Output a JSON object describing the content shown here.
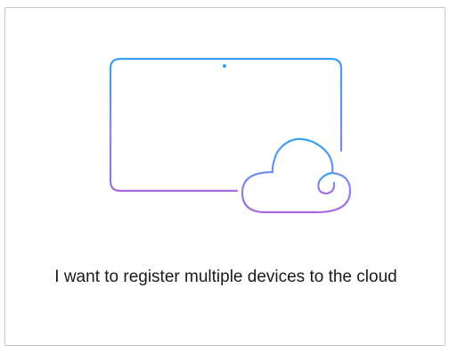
{
  "card": {
    "label": "I want to register multiple devices to the cloud",
    "illustration_icon": "tablet-cloud-icon",
    "gradient_colors": [
      "#3aa1f2",
      "#7b8cf0",
      "#a86be0"
    ]
  }
}
